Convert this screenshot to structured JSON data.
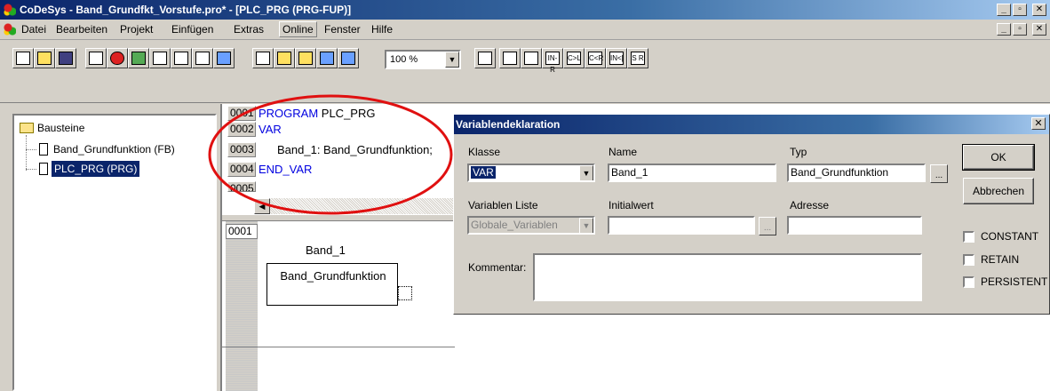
{
  "window": {
    "title": "CoDeSys - Band_Grundfkt_Vorstufe.pro* - [PLC_PRG (PRG-FUP)]",
    "controls": [
      "_",
      "□",
      "X"
    ]
  },
  "menu": {
    "items": [
      "Datei",
      "Bearbeiten",
      "Projekt",
      "Einfügen",
      "Extras",
      "Online",
      "Fenster",
      "Hilfe"
    ],
    "selected": "Online"
  },
  "toolbar": {
    "zoom": "100 %",
    "fbd_buttons": [
      "IN-R",
      "C>L",
      "C<R",
      "IN<[",
      "S R"
    ]
  },
  "tree": {
    "root": "Bausteine",
    "items": [
      "Band_Grundfunktion (FB)",
      "PLC_PRG (PRG)"
    ],
    "selected": "PLC_PRG (PRG)"
  },
  "declaration": {
    "line_numbers": [
      "0001",
      "0002",
      "0003",
      "0004",
      "0005"
    ],
    "lines": [
      {
        "kw": "PROGRAM",
        "text": " PLC_PRG"
      },
      {
        "kw": "VAR",
        "text": ""
      },
      {
        "kw": "",
        "text": "Band_1: Band_Grundfunktion;"
      },
      {
        "kw": "END_VAR",
        "text": ""
      }
    ]
  },
  "fbd": {
    "network": "0001",
    "instance_name": "Band_1",
    "block_type": "Band_Grundfunktion"
  },
  "dialog": {
    "title": "Variablendeklaration",
    "klasse_label": "Klasse",
    "klasse_value": "VAR",
    "name_label": "Name",
    "name_value": "Band_1",
    "typ_label": "Typ",
    "typ_value": "Band_Grundfunktion",
    "varliste_label": "Variablen Liste",
    "varliste_value": "Globale_Variablen",
    "initialwert_label": "Initialwert",
    "adresse_label": "Adresse",
    "kommentar_label": "Kommentar:",
    "ok_label": "OK",
    "abbrechen_label": "Abbrechen",
    "checkboxes": [
      "CONSTANT",
      "RETAIN",
      "PERSISTENT"
    ],
    "ellipsis": "..."
  },
  "annotation": {
    "color": "#e01010"
  }
}
